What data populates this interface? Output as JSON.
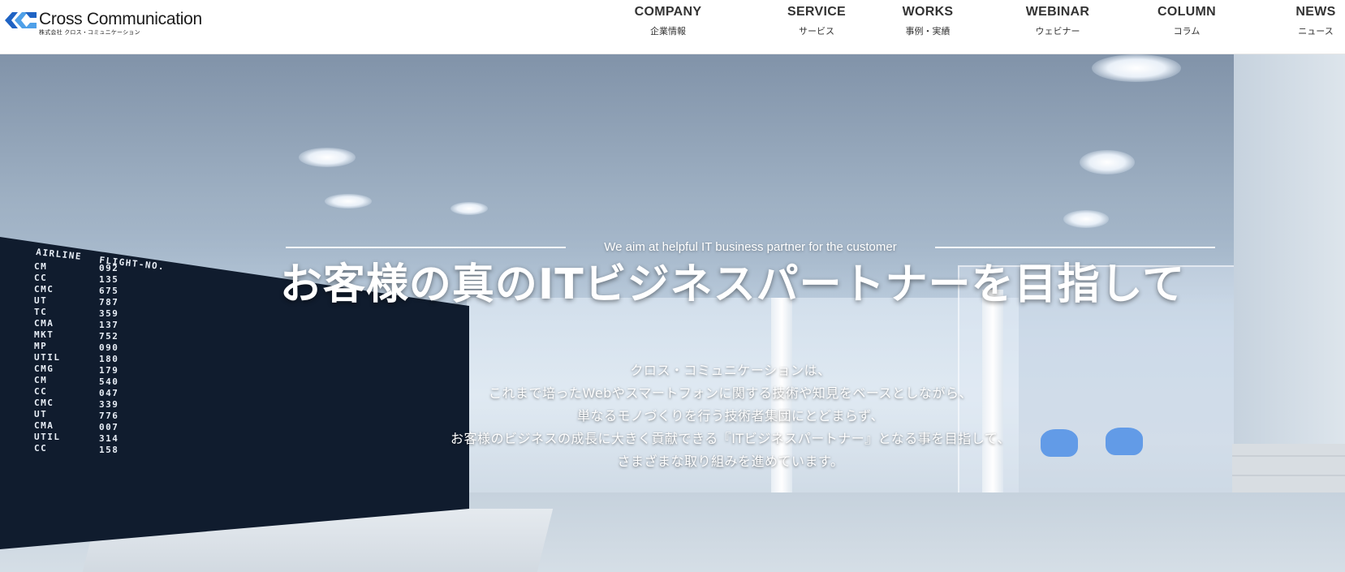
{
  "header": {
    "logo": {
      "name": "Cross Communication",
      "sub": "株式会社 クロス・コミュニケーション",
      "icon": "cross-communication-logo-icon"
    },
    "nav": [
      {
        "en": "COMPANY",
        "ja": "企業情報"
      },
      {
        "en": "SERVICE",
        "ja": "サービス"
      },
      {
        "en": "WORKS",
        "ja": "事例・実績"
      },
      {
        "en": "WEBINAR",
        "ja": "ウェビナー"
      },
      {
        "en": "COLUMN",
        "ja": "コラム"
      },
      {
        "en": "NEWS",
        "ja": "ニュース"
      }
    ]
  },
  "hero": {
    "tagline": "We aim at helpful IT business partner for the customer",
    "headline": "お客様の真のITビジネスパートナーを目指して",
    "intro": [
      "クロス・コミュニケーションは、",
      "これまで培ったWebやスマートフォンに関する技術や知見をベースとしながら、",
      "単なるモノづくりを行う技術者集団にとどまらず、",
      "お客様のビジネスの成長に大きく貢献できる『ITビジネスパートナー』となる事を目指して、",
      "さまざまな取り組みを進めています。"
    ],
    "background": "airport-lounge-photo",
    "board": {
      "headers": [
        "AIRLINE",
        "FLIGHT-NO."
      ],
      "rows_left": [
        [
          "CM",
          "092"
        ],
        [
          "CC",
          "135"
        ],
        [
          "CMC",
          "675"
        ],
        [
          "UT",
          "787"
        ],
        [
          "TC",
          "359"
        ],
        [
          "CMA",
          "137"
        ],
        [
          "MKT",
          "752"
        ],
        [
          "MP",
          "090"
        ],
        [
          "UTIL",
          "180"
        ],
        [
          "CMG",
          "179"
        ],
        [
          "CM",
          "540"
        ],
        [
          "CC",
          "047"
        ],
        [
          "CMC",
          "339"
        ],
        [
          "UT",
          "776"
        ],
        [
          "CMA",
          "007"
        ],
        [
          "UTIL",
          "314"
        ],
        [
          "CC",
          "158"
        ]
      ]
    }
  },
  "colors": {
    "nav_text": "#333333",
    "hero_text": "#ffffff",
    "board_bg": "#101c2e",
    "chair_accent": "#4f8fe6"
  }
}
